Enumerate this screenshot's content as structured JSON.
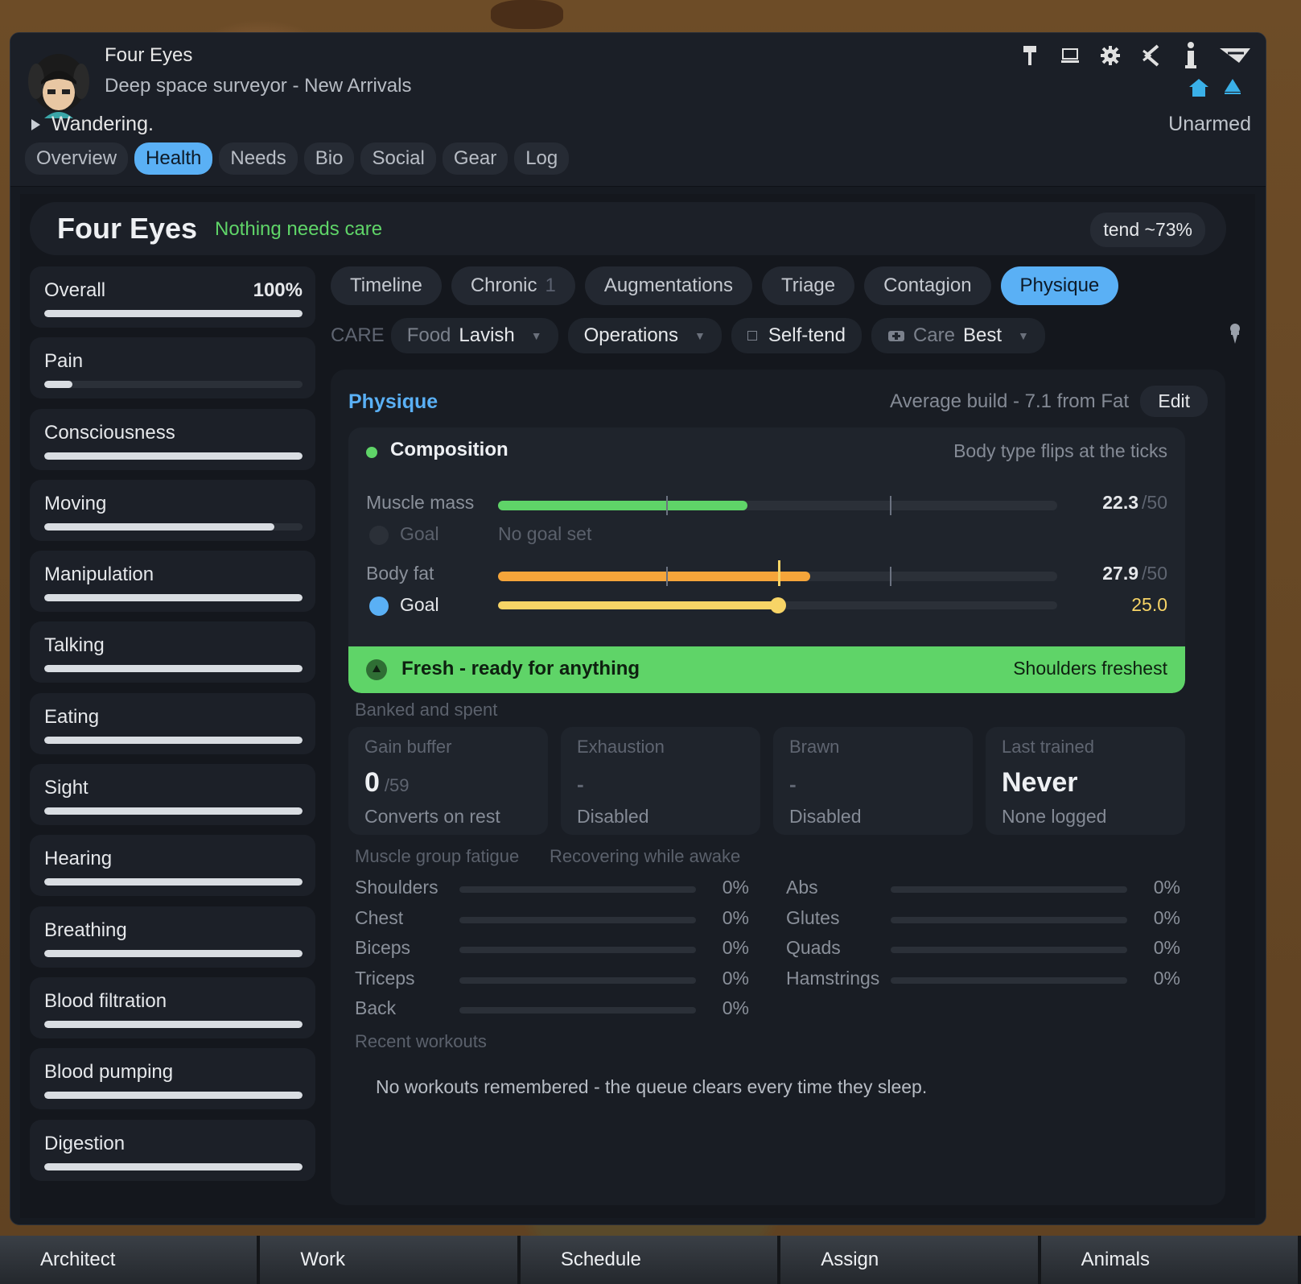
{
  "header": {
    "name": "Four Eyes",
    "subtitle": "Deep space surveyor - New Arrivals",
    "status": "Wandering.",
    "weapon": "Unarmed",
    "icons": [
      "hammer-icon",
      "laptop-icon",
      "gear-icon",
      "faction-icon",
      "info-icon",
      "collapse-icon",
      "home-icon",
      "rank-icon"
    ],
    "tabs": [
      "Overview",
      "Health",
      "Needs",
      "Bio",
      "Social",
      "Gear",
      "Log"
    ],
    "active_tab": "Health"
  },
  "health": {
    "name": "Four Eyes",
    "care_status": "Nothing needs care",
    "tend": "tend ~73%"
  },
  "capacities": [
    {
      "label": "Overall",
      "value": "100%",
      "fill": 1.0
    },
    {
      "label": "Pain",
      "value": "",
      "fill": 0.11
    },
    {
      "label": "Consciousness",
      "value": "",
      "fill": 1.0
    },
    {
      "label": "Moving",
      "value": "",
      "fill": 0.89
    },
    {
      "label": "Manipulation",
      "value": "",
      "fill": 1.0
    },
    {
      "label": "Talking",
      "value": "",
      "fill": 1.0
    },
    {
      "label": "Eating",
      "value": "",
      "fill": 1.0
    },
    {
      "label": "Sight",
      "value": "",
      "fill": 1.0
    },
    {
      "label": "Hearing",
      "value": "",
      "fill": 1.0
    },
    {
      "label": "Breathing",
      "value": "",
      "fill": 1.0
    },
    {
      "label": "Blood filtration",
      "value": "",
      "fill": 1.0
    },
    {
      "label": "Blood pumping",
      "value": "",
      "fill": 1.0
    },
    {
      "label": "Digestion",
      "value": "",
      "fill": 1.0
    }
  ],
  "subtabs": [
    {
      "label": "Timeline",
      "count": ""
    },
    {
      "label": "Chronic",
      "count": "1"
    },
    {
      "label": "Augmentations",
      "count": ""
    },
    {
      "label": "Triage",
      "count": ""
    },
    {
      "label": "Contagion",
      "count": ""
    },
    {
      "label": "Physique",
      "count": ""
    }
  ],
  "care": {
    "heading": "CARE",
    "food_key": "Food",
    "food_val": "Lavish",
    "operations": "Operations",
    "selftend": "Self-tend",
    "care_key": "Care",
    "care_val": "Best"
  },
  "physique": {
    "title": "Physique",
    "average": "Average build - 7.1 from Fat",
    "edit": "Edit",
    "composition": {
      "title": "Composition",
      "hint": "Body type flips at the ticks",
      "muscle_label": "Muscle mass",
      "muscle_value": "22.3",
      "muscle_max": "/50",
      "muscle_fill": 0.446,
      "muscle_goal_label": "Goal",
      "muscle_goal_text": "No goal set",
      "fat_label": "Body fat",
      "fat_value": "27.9",
      "fat_max": "/50",
      "fat_fill": 0.558,
      "fat_goal_label": "Goal",
      "fat_goal_value": "25.0",
      "fat_goal_fill": 0.5,
      "ticks": [
        0.3,
        0.7
      ]
    },
    "fresh": {
      "title": "Fresh - ready for anything",
      "detail": "Shoulders freshest"
    },
    "banked_title": "Banked and spent",
    "cards": [
      {
        "label": "Gain buffer",
        "value": "0",
        "of": "/59",
        "note": "Converts on rest"
      },
      {
        "label": "Exhaustion",
        "value": "-",
        "of": "",
        "note": "Disabled"
      },
      {
        "label": "Brawn",
        "value": "-",
        "of": "",
        "note": "Disabled"
      },
      {
        "label": "Last trained",
        "value": "Never",
        "of": "",
        "note": "None logged"
      }
    ],
    "fatigue_title": "Muscle group fatigue",
    "fatigue_sub": "Recovering while awake",
    "fatigue_left": [
      {
        "name": "Shoulders",
        "pct": "0%"
      },
      {
        "name": "Chest",
        "pct": "0%"
      },
      {
        "name": "Biceps",
        "pct": "0%"
      },
      {
        "name": "Triceps",
        "pct": "0%"
      },
      {
        "name": "Back",
        "pct": "0%"
      }
    ],
    "fatigue_right": [
      {
        "name": "Abs",
        "pct": "0%"
      },
      {
        "name": "Glutes",
        "pct": "0%"
      },
      {
        "name": "Quads",
        "pct": "0%"
      },
      {
        "name": "Hamstrings",
        "pct": "0%"
      }
    ],
    "recent_title": "Recent workouts",
    "recent_text": "No workouts remembered - the queue clears every time they sleep."
  },
  "bottom_tabs": [
    "Architect",
    "Work",
    "Schedule",
    "Assign",
    "Animals"
  ],
  "colors": {
    "accent": "#5ab0f5",
    "good": "#5fd468",
    "fat": "#f5a53a",
    "goal": "#f7d466"
  }
}
